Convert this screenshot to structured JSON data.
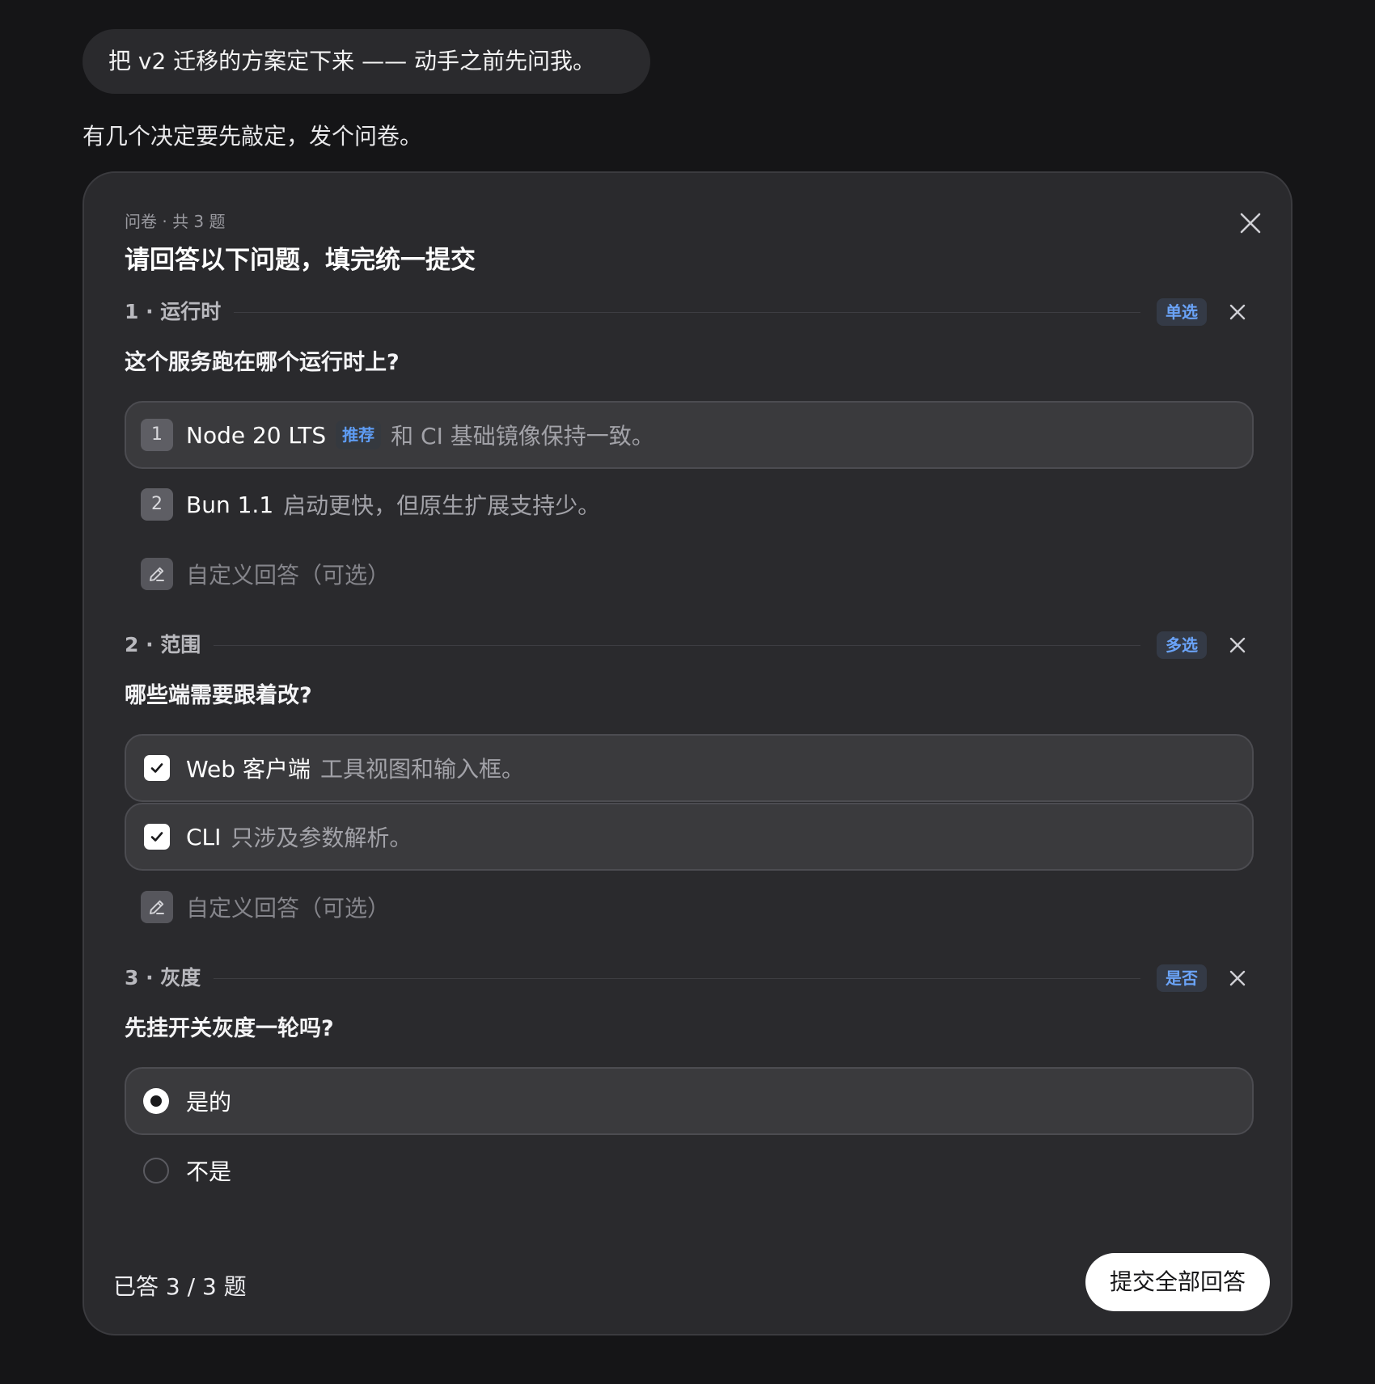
{
  "user_message": "把 v2 迁移的方案定下来 —— 动手之前先问我。",
  "assistant_message": "有几个决定要先敲定，发个问卷。",
  "questionnaire": {
    "meta": "问卷 · 共 3 题",
    "title": "请回答以下问题，填完统一提交",
    "sections": [
      {
        "label": "1 · 运行时",
        "badge": "单选",
        "question": "这个服务跑在哪个运行时上?",
        "options": [
          {
            "index": "1",
            "label": "Node 20 LTS",
            "tag": "推荐",
            "desc": "和 CI 基础镜像保持一致。",
            "selected": true
          },
          {
            "index": "2",
            "label": "Bun 1.1",
            "desc": "启动更快，但原生扩展支持少。",
            "selected": false
          }
        ],
        "custom_placeholder": "自定义回答（可选）"
      },
      {
        "label": "2 · 范围",
        "badge": "多选",
        "question": "哪些端需要跟着改?",
        "options": [
          {
            "label": "Web 客户端",
            "desc": "工具视图和输入框。",
            "checked": true
          },
          {
            "label": "CLI",
            "desc": "只涉及参数解析。",
            "checked": true
          }
        ],
        "custom_placeholder": "自定义回答（可选）"
      },
      {
        "label": "3 · 灰度",
        "badge": "是否",
        "question": "先挂开关灰度一轮吗?",
        "options": [
          {
            "label": "是的",
            "selected": true
          },
          {
            "label": "不是",
            "selected": false
          }
        ]
      }
    ],
    "progress_text": "已答 3 / 3 题",
    "answered": 3,
    "total": 3,
    "submit_label": "提交全部回答"
  },
  "colors": {
    "page_bg": "#151517",
    "card_bg": "#2a2a2d",
    "accent_blue": "#6aa3f7",
    "submit_bg": "#ffffff"
  },
  "icons": [
    "close-icon",
    "edit-icon",
    "checkmark-icon"
  ]
}
